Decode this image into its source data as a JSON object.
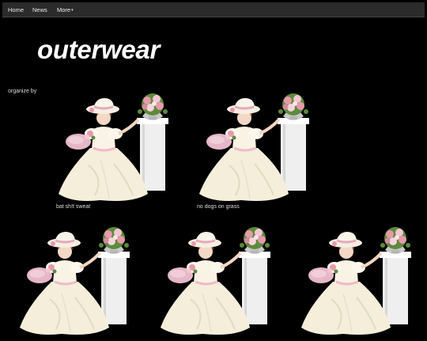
{
  "nav": {
    "items": [
      {
        "label": "Home"
      },
      {
        "label": "News"
      },
      {
        "label": "More"
      }
    ],
    "more_caret": "▾"
  },
  "page": {
    "title": "outerwear",
    "organize_label": "organize by"
  },
  "gallery": {
    "image_name": "victorian-lady-with-flowers",
    "colors": {
      "dress": "#f4eedb",
      "pillar": "#efefef",
      "cushion": "#e5b7c8",
      "flowers_pink": "#e79aaa",
      "leaves": "#5d8a3c"
    },
    "items": [
      {
        "caption": "bat sh!t sweat"
      },
      {
        "caption": "no dogs on grass"
      },
      {
        "caption": ""
      },
      {
        "caption": ""
      },
      {
        "caption": ""
      }
    ]
  }
}
